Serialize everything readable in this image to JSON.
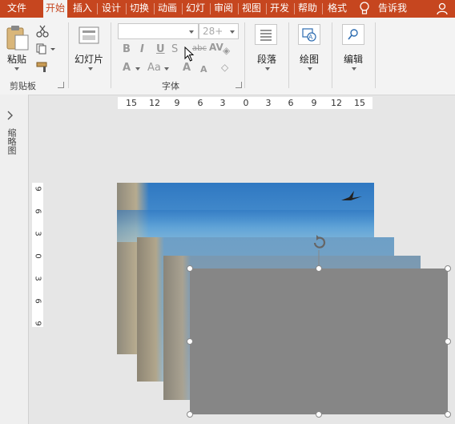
{
  "tabs": [
    {
      "label": "文件",
      "active": false
    },
    {
      "label": "开始",
      "active": true
    },
    {
      "label": "插入",
      "active": false
    },
    {
      "label": "设计",
      "active": false
    },
    {
      "label": "切换",
      "active": false
    },
    {
      "label": "动画",
      "active": false
    },
    {
      "label": "幻灯",
      "active": false
    },
    {
      "label": "审阅",
      "active": false
    },
    {
      "label": "视图",
      "active": false
    },
    {
      "label": "开发",
      "active": false
    },
    {
      "label": "帮助",
      "active": false
    },
    {
      "label": "格式",
      "active": false
    }
  ],
  "tell_me": "告诉我",
  "ribbon": {
    "clipboard": {
      "paste_label": "粘贴",
      "group_label": "剪贴板"
    },
    "slides": {
      "label": "幻灯片"
    },
    "font": {
      "font_size": "28+",
      "group_label": "字体"
    },
    "paragraph": {
      "label": "段落"
    },
    "drawing": {
      "label": "绘图"
    },
    "editing": {
      "label": "编辑"
    }
  },
  "thumbnail_pane_label": "缩略图",
  "hruler_ticks": [
    "15",
    "12",
    "9",
    "6",
    "3",
    "0",
    "3",
    "6",
    "9",
    "12",
    "15"
  ],
  "vruler_ticks": [
    "9",
    "6",
    "3",
    "0",
    "3",
    "6",
    "9"
  ],
  "colors": {
    "accent": "#c6461f",
    "selection_fill": "#868686"
  }
}
